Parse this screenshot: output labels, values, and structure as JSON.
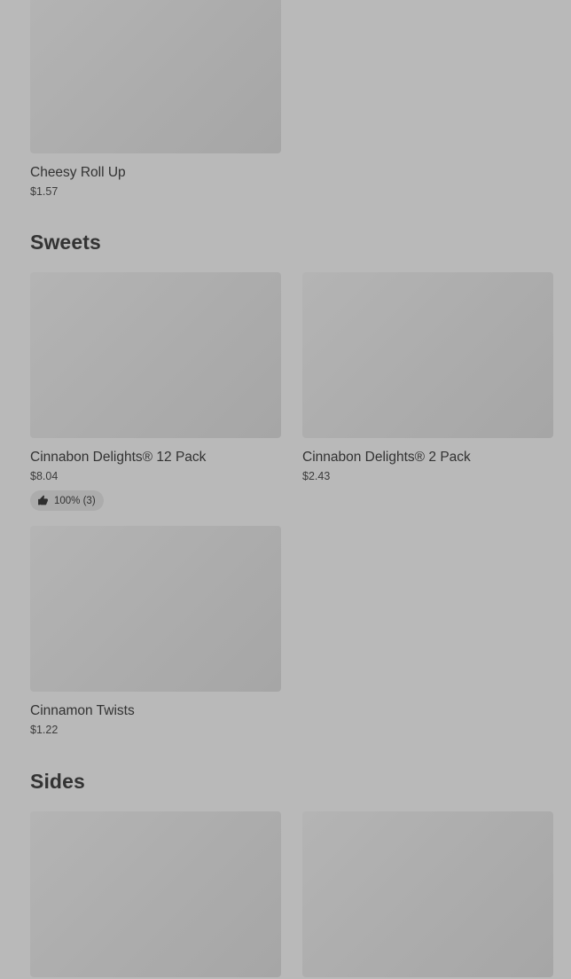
{
  "sections": [
    {
      "title": null,
      "items": [
        {
          "name": "Cheesy Roll Up",
          "price": "$1.57"
        }
      ]
    },
    {
      "title": "Sweets",
      "items": [
        {
          "name": "Cinnabon Delights® 12 Pack",
          "price": "$8.04",
          "rating": {
            "icon": "thumbs-up-icon",
            "text": "100% (3)"
          }
        },
        {
          "name": "Cinnabon Delights® 2 Pack",
          "price": "$2.43"
        },
        {
          "name": "Cinnamon Twists",
          "price": "$1.22"
        }
      ]
    },
    {
      "title": "Sides",
      "items": [
        {
          "name": "",
          "price": ""
        },
        {
          "name": "",
          "price": ""
        }
      ]
    }
  ]
}
